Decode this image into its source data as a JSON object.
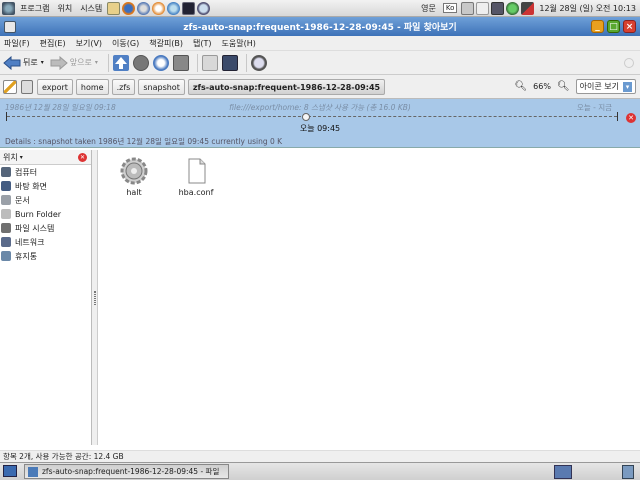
{
  "top_panel": {
    "menus": [
      "프로그램",
      "위치",
      "시스템"
    ],
    "input_lang": "영문",
    "input_mode": "Ko",
    "clock": "12월 28일 (일) 오전 10:13"
  },
  "window": {
    "title": "zfs-auto-snap:frequent-1986-12-28-09:45 - 파일 찾아보기"
  },
  "menubar": [
    "파일(F)",
    "편집(E)",
    "보기(V)",
    "이동(G)",
    "책갈피(B)",
    "탭(T)",
    "도움말(H)"
  ],
  "toolbar": {
    "back_label": "뒤로",
    "forward_label": "앞으로"
  },
  "location": {
    "crumbs": [
      "export",
      "home",
      ".zfs",
      "snapshot",
      "zfs-auto-snap:frequent-1986-12-28-09:45"
    ],
    "zoom": "66%",
    "view_mode": "아이콘 보기"
  },
  "time_slider": {
    "left_date": "1986년 12월 28일 일요일 09:18",
    "info": "file:///export/home: 8 스냅샷 사용 가능 (총 16.0 KB)",
    "right_label": "오늘 - 지금",
    "current_time": "오늘 09:45",
    "details": "Details : snapshot taken 1986년 12월 28일 일요일 09:45 currently using 0 K",
    "position": 0.49
  },
  "sidepane": {
    "header": "위치",
    "places": [
      {
        "label": "컴퓨터",
        "icon": "computer-icon",
        "color": "#55657a"
      },
      {
        "label": "바탕 화면",
        "icon": "desktop-icon",
        "color": "#445c82"
      },
      {
        "label": "문서",
        "icon": "documents-icon",
        "color": "#9aa0a8"
      },
      {
        "label": "Burn Folder",
        "icon": "cd-burn-icon",
        "color": "#bcbcbc"
      },
      {
        "label": "파일 시스템",
        "icon": "filesystem-icon",
        "color": "#707070"
      },
      {
        "label": "네트워크",
        "icon": "network-icon",
        "color": "#5a6a8a"
      },
      {
        "label": "휴지통",
        "icon": "trash-icon",
        "color": "#6a88a8"
      }
    ]
  },
  "files": [
    {
      "name": "halt",
      "icon": "gear-executable-icon"
    },
    {
      "name": "hba.conf",
      "icon": "text-file-icon"
    }
  ],
  "status_bar": "항목 2개, 사용 가능한 공간: 12.4 GB",
  "taskbar": {
    "task_label": "zfs-auto-snap:frequent-1986-12-28-09:45 - 파일"
  }
}
